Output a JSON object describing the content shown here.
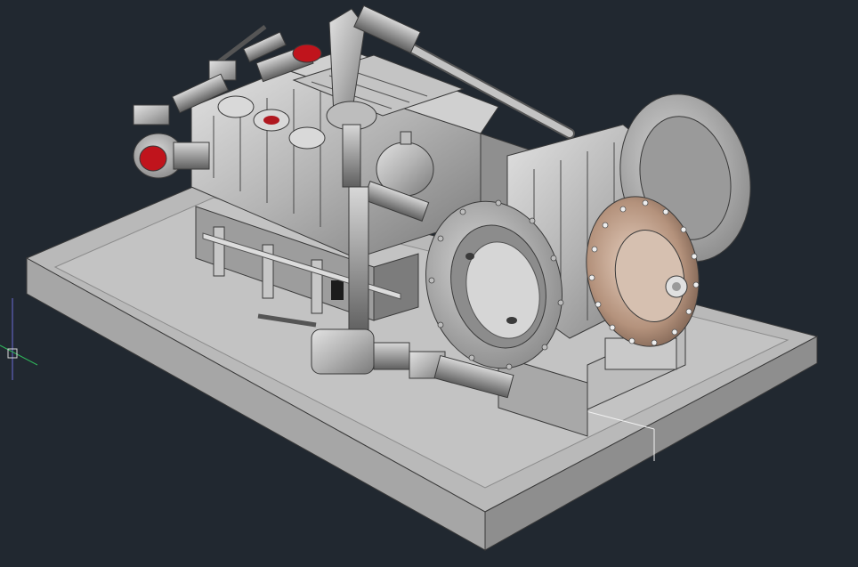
{
  "app": {
    "title": "",
    "background_color": "#212830"
  },
  "viewport": {
    "visual_style": "Shaded",
    "view": "SW Isometric"
  },
  "model": {
    "description_label": "",
    "colors": {
      "base_plate_top": "#b9b9b9",
      "base_plate_side": "#8e8e8e",
      "base_plate_front": "#a5a5a5",
      "metal_light": "#cfcfcf",
      "metal_mid": "#a9a9a9",
      "metal_dark": "#6f6f6f",
      "bronze": "#b89a86",
      "red_port": "#c0141c",
      "edge": "#3a3a3a"
    }
  },
  "ucs_icon": {
    "x_axis_color": "#2fb35a",
    "y_axis_color": "#6b6bd6",
    "cursor_color": "#d8d8d8"
  }
}
